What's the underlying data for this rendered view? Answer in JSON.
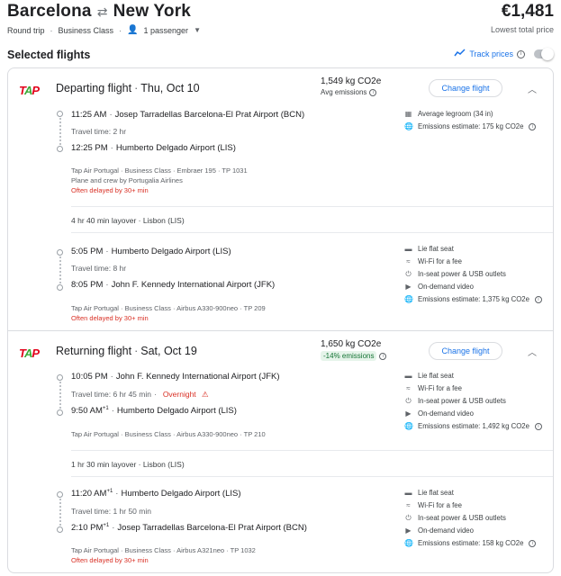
{
  "header": {
    "origin": "Barcelona",
    "swap_icon": "⇄",
    "destination": "New York",
    "price": "€1,481",
    "trip_type": "Round trip",
    "cabin": "Business Class",
    "passengers": "1 passenger",
    "lowest_label": "Lowest total price"
  },
  "selected": {
    "title": "Selected flights",
    "track_label": "Track prices"
  },
  "depart": {
    "logo": "TAP",
    "direction": "Departing flight",
    "date": "Thu, Oct 10",
    "emissions": "1,549 kg CO2e",
    "emissions_sub": "Avg emissions",
    "change_label": "Change flight",
    "leg1": {
      "dep_time": "11:25 AM",
      "dep_airport": "Josep Tarradellas Barcelona-El Prat Airport (BCN)",
      "travel_time": "Travel time: 2 hr",
      "arr_time": "12:25 PM",
      "arr_airport": "Humberto Delgado Airport (LIS)",
      "details": "Tap Air Portugal · Business Class · Embraer 195 · TP 1031",
      "operated": "Plane and crew by Portugalia Airlines",
      "delay": "Often delayed by 30+ min",
      "amenities": [
        "Average legroom (34 in)",
        "Emissions estimate: 175 kg CO2e"
      ]
    },
    "layover": "4 hr 40 min layover · Lisbon (LIS)",
    "leg2": {
      "dep_time": "5:05 PM",
      "dep_airport": "Humberto Delgado Airport (LIS)",
      "travel_time": "Travel time: 8 hr",
      "arr_time": "8:05 PM",
      "arr_airport": "John F. Kennedy International Airport (JFK)",
      "details": "Tap Air Portugal · Business Class · Airbus A330-900neo · TP 209",
      "delay": "Often delayed by 30+ min",
      "amenities": [
        "Lie flat seat",
        "Wi-Fi for a fee",
        "In-seat power & USB outlets",
        "On-demand video",
        "Emissions estimate: 1,375 kg CO2e"
      ]
    }
  },
  "return": {
    "logo": "TAP",
    "direction": "Returning flight",
    "date": "Sat, Oct 19",
    "emissions": "1,650 kg CO2e",
    "emissions_badge": "-14% emissions",
    "change_label": "Change flight",
    "leg1": {
      "dep_time": "10:05 PM",
      "dep_airport": "John F. Kennedy International Airport (JFK)",
      "travel_time": "Travel time: 6 hr 45 min",
      "overnight": "Overnight",
      "arr_time": "9:50 AM",
      "arr_sup": "+1",
      "arr_airport": "Humberto Delgado Airport (LIS)",
      "details": "Tap Air Portugal · Business Class · Airbus A330-900neo · TP 210",
      "amenities": [
        "Lie flat seat",
        "Wi-Fi for a fee",
        "In-seat power & USB outlets",
        "On-demand video",
        "Emissions estimate: 1,492 kg CO2e"
      ]
    },
    "layover": "1 hr 30 min layover · Lisbon (LIS)",
    "leg2": {
      "dep_time": "11:20 AM",
      "dep_sup": "+1",
      "dep_airport": "Humberto Delgado Airport (LIS)",
      "travel_time": "Travel time: 1 hr 50 min",
      "arr_time": "2:10 PM",
      "arr_sup": "+1",
      "arr_airport": "Josep Tarradellas Barcelona-El Prat Airport (BCN)",
      "details": "Tap Air Portugal · Business Class · Airbus A321neo · TP 1032",
      "delay": "Often delayed by 30+ min",
      "amenities": [
        "Lie flat seat",
        "Wi-Fi for a fee",
        "In-seat power & USB outlets",
        "On-demand video",
        "Emissions estimate: 158 kg CO2e"
      ]
    }
  },
  "colors": {
    "accent": "#1a73e8",
    "warning": "#d93025",
    "tap_red": "#e2001a",
    "tap_green": "#3aaa35"
  }
}
